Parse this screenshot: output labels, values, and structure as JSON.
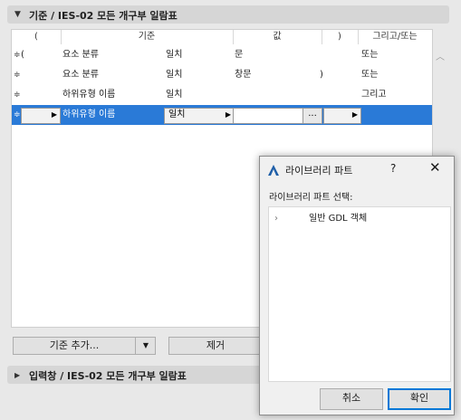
{
  "criteria_section": {
    "title": "기준 / IES-02 모든 개구부 일람표"
  },
  "table": {
    "columns": {
      "open_paren": "(",
      "criterion": "기준",
      "value": "값",
      "close_paren": ")",
      "and_or": "그리고/또는"
    },
    "rows": [
      {
        "grip": "≑",
        "open_paren": "(",
        "criterion": "요소 분류",
        "operator": "일치",
        "value": "문",
        "close_paren": "",
        "and_or": "또는"
      },
      {
        "grip": "≑",
        "open_paren": "",
        "criterion": "요소 분류",
        "operator": "일치",
        "value": "창문",
        "close_paren": ")",
        "and_or": "또는"
      },
      {
        "grip": "≑",
        "open_paren": "",
        "criterion": "하위유형 이름",
        "operator": "일치",
        "value": "",
        "close_paren": "",
        "and_or": "그리고"
      },
      {
        "grip": "≑",
        "open_paren": "",
        "criterion": "하위유형 이름",
        "operator": "일치",
        "value": "",
        "close_paren": "",
        "and_or": ""
      }
    ],
    "selected_row": {
      "operator_dropdown": "일치",
      "value_button": "..."
    }
  },
  "buttons": {
    "add_criterion": "기준 추가...",
    "remove": "제거"
  },
  "input_section": {
    "title": "입력창 / IES-02 모든 개구부 일람표"
  },
  "dialog": {
    "title": "라이브러리 파트",
    "help": "?",
    "close": "✕",
    "label": "라이브러리 파트 선택:",
    "items": [
      {
        "label": "일반 GDL 객체"
      }
    ],
    "cancel": "취소",
    "ok": "확인"
  },
  "colors": {
    "selection": "#2a7ad7",
    "accent": "#0078d7"
  }
}
